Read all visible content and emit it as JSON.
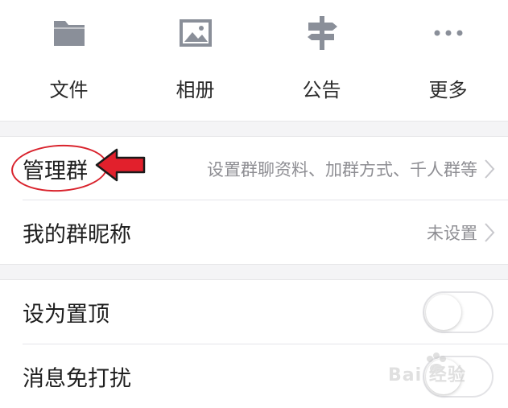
{
  "quick_actions": [
    {
      "label": "文件",
      "icon": "folder-icon"
    },
    {
      "label": "相册",
      "icon": "photo-icon"
    },
    {
      "label": "公告",
      "icon": "signpost-icon"
    },
    {
      "label": "更多",
      "icon": "more-icon"
    }
  ],
  "settings": {
    "manage_group": {
      "title": "管理群",
      "value": "设置群聊资料、加群方式、千人群等"
    },
    "my_nickname": {
      "title": "我的群昵称",
      "value": "未设置"
    },
    "pin_top": {
      "title": "设为置顶",
      "toggle_on": false
    },
    "do_not_disturb": {
      "title": "消息免打扰",
      "toggle_on": false
    }
  },
  "annotation": {
    "color": "#d9232d"
  },
  "watermark": {
    "text": "Bai  经验"
  },
  "colors": {
    "icon": "#8a8f99",
    "section_bg": "#f4f4f6",
    "secondary_text": "#8e8e93"
  }
}
